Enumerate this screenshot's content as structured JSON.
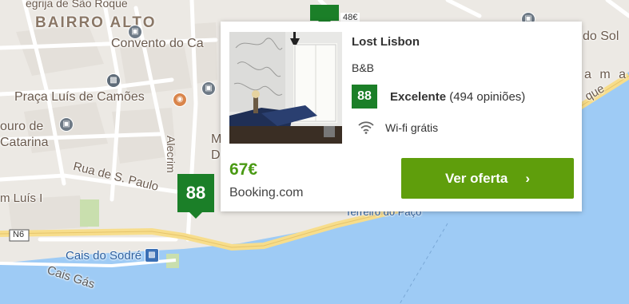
{
  "map": {
    "labels": {
      "top_cut": "egrija de São Roque",
      "bairro_alto": "BAIRRO ALTO",
      "convento": "Convento do Ca",
      "praca": "Praça Luís de Camões",
      "ouro_de": "ouro de",
      "catarina": "Catarina",
      "alecrim": "Alecrim",
      "rua_s_paulo": "Rua de S. Paulo",
      "m_luis": "m Luís I",
      "n6": "N6",
      "cais_sodre": "Cais do Sodré",
      "cais_gas": "Cais Gás",
      "do_sol": "do Sol",
      "amar": "a m a",
      "que": "que",
      "terreiro": "Terreiro do Paço",
      "marker_top_price": "48€",
      "m_cut": "M",
      "d_cut": "D"
    },
    "colors": {
      "land": "#ece9e4",
      "road": "#ffffff",
      "highway": "#f7dd8b",
      "water": "#9ecbf5",
      "park": "#c9dfae"
    }
  },
  "marker": {
    "score": "88"
  },
  "card": {
    "name": "Lost Lisbon",
    "type": "B&B",
    "score": "88",
    "rating_label": "Excelente",
    "reviews": "(494 opiniões)",
    "amenity": "Wi-fi grátis",
    "price": "67€",
    "provider": "Booking.com",
    "cta_label": "Ver oferta",
    "cta_chevron": "›",
    "colors": {
      "score_bg": "#1b7f28",
      "price": "#4a9a14",
      "cta_bg": "#5f9e0c"
    },
    "icons": {
      "wifi": "wifi-icon",
      "chevron": "chevron-right-icon"
    }
  }
}
